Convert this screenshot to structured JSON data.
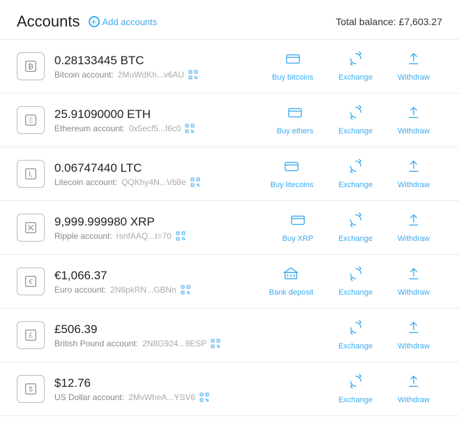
{
  "header": {
    "title": "Accounts",
    "add_accounts_label": "Add accounts",
    "total_balance_label": "Total balance:",
    "total_balance_value": "£7,603.27"
  },
  "accounts": [
    {
      "id": "btc",
      "amount": "0.28133445 BTC",
      "account_label": "Bitcoin account:",
      "address": "2MuWdKh...v6AU",
      "icon_type": "btc",
      "actions": [
        "Buy bitcoins",
        "Exchange",
        "Withdraw"
      ],
      "show_buy": true
    },
    {
      "id": "eth",
      "amount": "25.91090000 ETH",
      "account_label": "Ethereum account:",
      "address": "0x5ecf5...f6c0",
      "icon_type": "eth",
      "actions": [
        "Buy ethers",
        "Exchange",
        "Withdraw"
      ],
      "show_buy": true
    },
    {
      "id": "ltc",
      "amount": "0.06747440 LTC",
      "account_label": "Litecoin account:",
      "address": "QQKhy4N...Vb8e",
      "icon_type": "ltc",
      "actions": [
        "Buy litecoins",
        "Exchange",
        "Withdraw"
      ],
      "show_buy": true
    },
    {
      "id": "xrp",
      "amount": "9,999.999980 XRP",
      "account_label": "Ripple account:",
      "address": "rsnfAAQ...t=70",
      "icon_type": "xrp",
      "actions": [
        "Buy XRP",
        "Exchange",
        "Withdraw"
      ],
      "show_buy": true
    },
    {
      "id": "eur",
      "amount": "€1,066.37",
      "account_label": "Euro account:",
      "address": "2N6pkRN...GBNn",
      "icon_type": "eur",
      "actions": [
        "Bank deposit",
        "Exchange",
        "Withdraw"
      ],
      "show_buy": true
    },
    {
      "id": "gbp",
      "amount": "£506.39",
      "account_label": "British Pound account:",
      "address": "2N8G924...9ESP",
      "icon_type": "gbp",
      "actions": [
        "Exchange",
        "Withdraw"
      ],
      "show_buy": false
    },
    {
      "id": "usd",
      "amount": "$12.76",
      "account_label": "US Dollar account:",
      "address": "2MvWheA...YSV6",
      "icon_type": "usd",
      "actions": [
        "Exchange",
        "Withdraw"
      ],
      "show_buy": false
    }
  ]
}
